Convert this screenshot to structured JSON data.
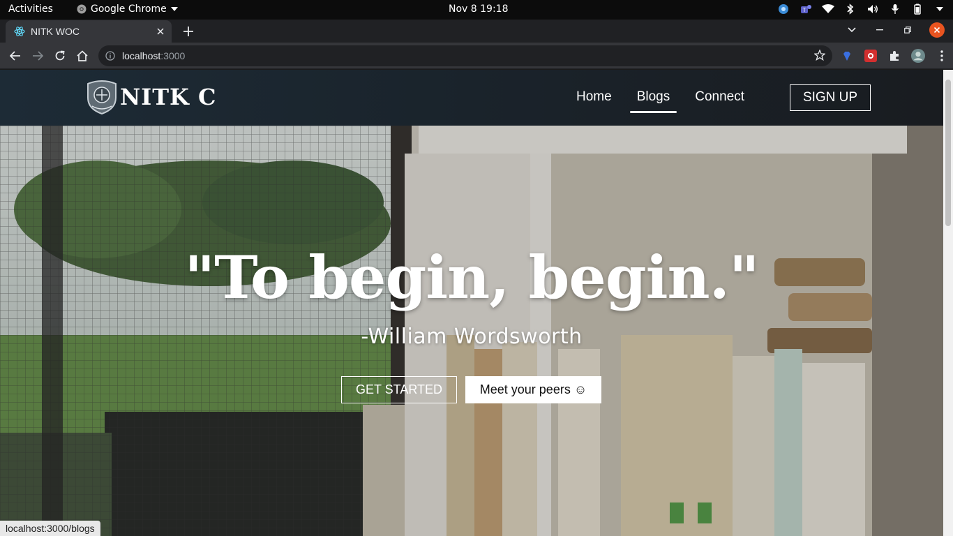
{
  "system": {
    "activities": "Activities",
    "app_name": "Google Chrome",
    "clock": "Nov 8  19:18"
  },
  "browser": {
    "tab_title": "NITK WOC",
    "url_host": "localhost",
    "url_port": ":3000",
    "status_url": "localhost:3000/blogs"
  },
  "site": {
    "brand": "NITK C",
    "nav": [
      "Home",
      "Blogs",
      "Connect"
    ],
    "active_nav": "Blogs",
    "signup": "SIGN UP"
  },
  "hero": {
    "quote": "\"To begin, begin.\"",
    "author": "-William Wordsworth",
    "cta_primary": "GET STARTED",
    "cta_secondary": "Meet your peers ☺"
  },
  "colors": {
    "accent_close": "#e95420",
    "nav_bg": "#1d2b36"
  }
}
